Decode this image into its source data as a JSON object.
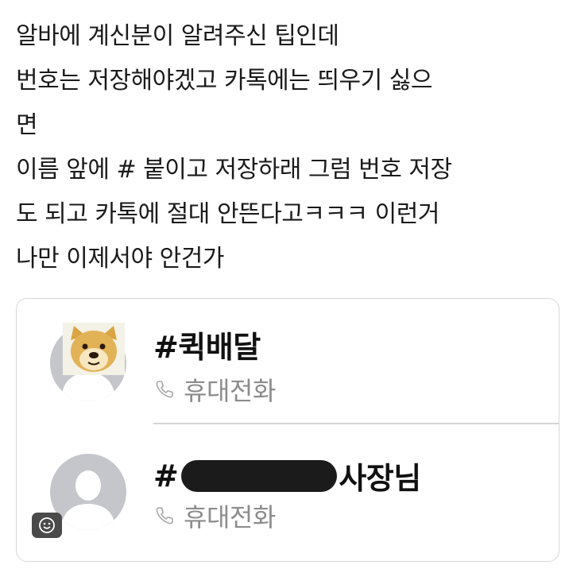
{
  "post": {
    "lines": [
      "알바에 계신분이 알려주신 팁인데",
      "번호는 저장해야겠고 카톡에는 띄우기 싫으",
      "면",
      "이름 앞에 # 붙이고 저장하래 그럼 번호 저장",
      "도 되고 카톡에 절대 안뜬다고ㅋㅋㅋ 이런거",
      "나만 이제서야 안건가"
    ]
  },
  "contacts": [
    {
      "name": "#퀵배달",
      "phone_type": "휴대전화",
      "avatar": "doge-icon"
    },
    {
      "name_prefix": "#",
      "name_suffix": "사장님",
      "phone_type": "휴대전화",
      "avatar": "default-person-icon",
      "redacted": true
    }
  ],
  "colors": {
    "text": "#1a1a1a",
    "subtext": "#8c8c8c",
    "avatar_bg": "#c4c6cb",
    "redaction": "#1b1b1b"
  },
  "icons": {
    "phone": "phone-icon",
    "emoji": "emoji-icon"
  }
}
